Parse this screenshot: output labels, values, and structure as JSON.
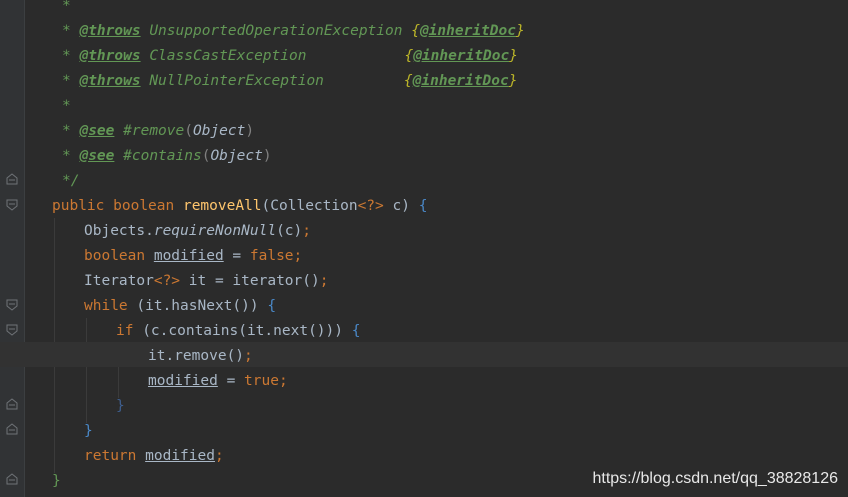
{
  "doc": {
    "star": "*",
    "close": "*/",
    "throws_tag": "@throws",
    "see_tag": "@see",
    "inheritdoc_open": "{",
    "inheritdoc_tag": "@inheritDoc",
    "inheritdoc_close": "}",
    "exceptions": [
      "UnsupportedOperationException",
      "ClassCastException",
      "NullPointerException"
    ],
    "see_refs": [
      {
        "hash": "#remove",
        "paren_open": "(",
        "type": "Object",
        "paren_close": ")"
      },
      {
        "hash": "#contains",
        "paren_open": "(",
        "type": "Object",
        "paren_close": ")"
      }
    ]
  },
  "code": {
    "signature": {
      "public": "public",
      "boolean": "boolean",
      "name": "removeAll",
      "params": "(Collection",
      "generic": "<?>",
      "param_name": " c) ",
      "open": "{"
    },
    "l1": {
      "a": "Objects.",
      "b": "requireNonNull",
      "c": "(c)",
      "d": ";"
    },
    "l2": {
      "type": "boolean",
      "var": "modified",
      "eq": " = ",
      "val": "false",
      "semi": ";"
    },
    "l3": {
      "type": "Iterator",
      "generic": "<?>",
      "rest": " it = iterator()",
      "semi": ";"
    },
    "l4": {
      "kw": "while",
      "cond": " (it.hasNext()) ",
      "open": "{"
    },
    "l5": {
      "kw": "if",
      "cond": " (c.contains(it.next())) ",
      "open": "{"
    },
    "l6": {
      "call": "it.remove()",
      "semi": ";"
    },
    "l7": {
      "var": "modified",
      "eq": " = ",
      "val": "true",
      "semi": ";"
    },
    "l8": {
      "close": "}"
    },
    "l9": {
      "close": "}"
    },
    "l10": {
      "kw": "return",
      "sp": " ",
      "var": "modified",
      "semi": ";"
    },
    "l11": {
      "close": "}"
    }
  },
  "watermark": "https://blog.csdn.net/qq_38828126",
  "colors": {
    "background": "#2b2b2b",
    "doc_comment": "#629755",
    "keyword": "#cc7832",
    "method": "#ffc66d",
    "identifier": "#a9b7c6",
    "brace": "#4a88c7"
  }
}
